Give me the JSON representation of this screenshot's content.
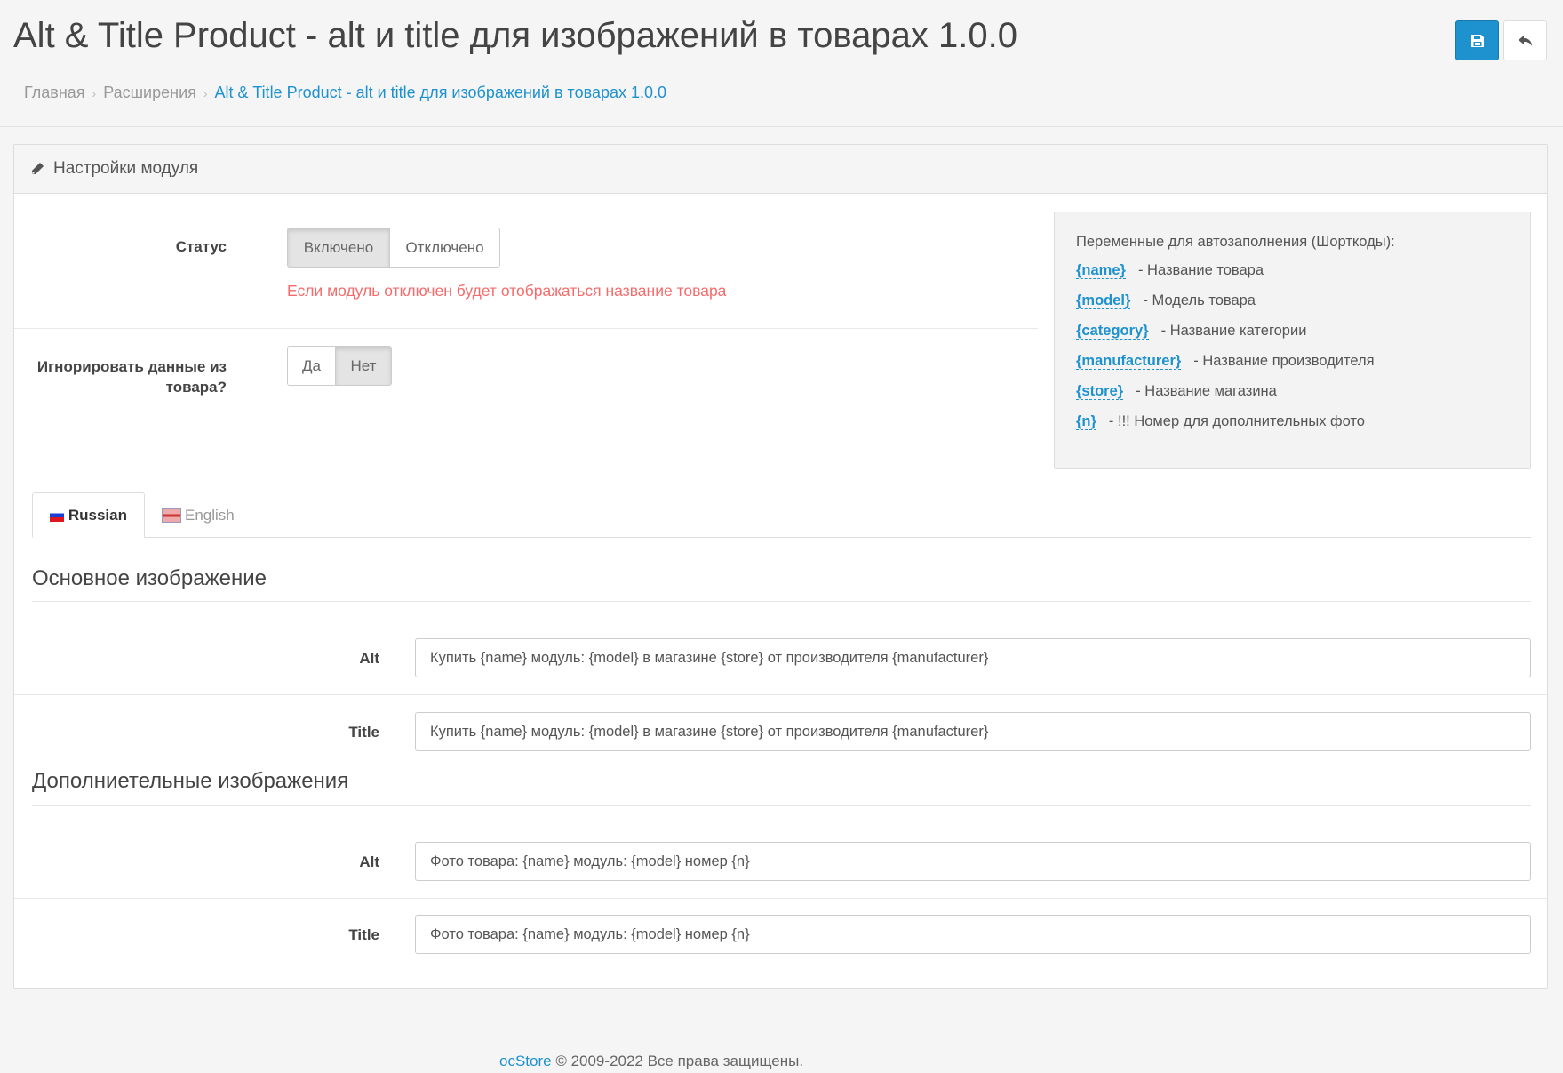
{
  "header": {
    "title": "Alt & Title Product - alt и title для изображений в товарах 1.0.0",
    "save_icon": "floppy-disk-icon",
    "back_icon": "reply-icon"
  },
  "breadcrumb": [
    {
      "label": "Главная"
    },
    {
      "label": "Расширения"
    },
    {
      "label": "Alt & Title Product - alt и title для изображений в товарах 1.0.0"
    }
  ],
  "panel": {
    "title": "Настройки модуля",
    "icon": "pencil-icon"
  },
  "status": {
    "label": "Статус",
    "options": [
      "Включено",
      "Отключено"
    ],
    "selected": "Включено",
    "help": "Если модуль отключен будет отображаться название товара"
  },
  "ignore": {
    "label_line1": "Игнорировать данные из",
    "label_line2": "товара?",
    "options": [
      "Да",
      "Нет"
    ],
    "selected": "Нет"
  },
  "shortcodes": {
    "title": "Переменные для автозаполнения (Шорткоды):",
    "items": [
      {
        "code": "{name}",
        "desc": "- Название товара"
      },
      {
        "code": "{model}",
        "desc": "- Модель товара"
      },
      {
        "code": "{category}",
        "desc": "- Название категории"
      },
      {
        "code": "{manufacturer}",
        "desc": "- Название производителя"
      },
      {
        "code": "{store}",
        "desc": "- Название магазина"
      },
      {
        "code": "{n}",
        "desc": "- !!! Номер для дополнительных фото"
      }
    ]
  },
  "tabs": [
    {
      "label": "Russian",
      "active": true
    },
    {
      "label": "English",
      "active": false
    }
  ],
  "main_image": {
    "title": "Основное изображение",
    "alt_label": "Alt",
    "alt_value": "Купить {name} модуль: {model} в магазине {store} от производителя {manufacturer}",
    "title_label": "Title",
    "title_value": "Купить {name} модуль: {model} в магазине {store} от производителя {manufacturer}"
  },
  "additional_images": {
    "title": "Дополниетельные изображения",
    "alt_label": "Alt",
    "alt_value": "Фото товара: {name} модуль: {model}  номер {n}",
    "title_label": "Title",
    "title_value": "Фото товара: {name} модуль: {model}  номер {n}"
  },
  "footer": {
    "brand": "ocStore",
    "text": " © 2009-2022 Все права защищены."
  }
}
